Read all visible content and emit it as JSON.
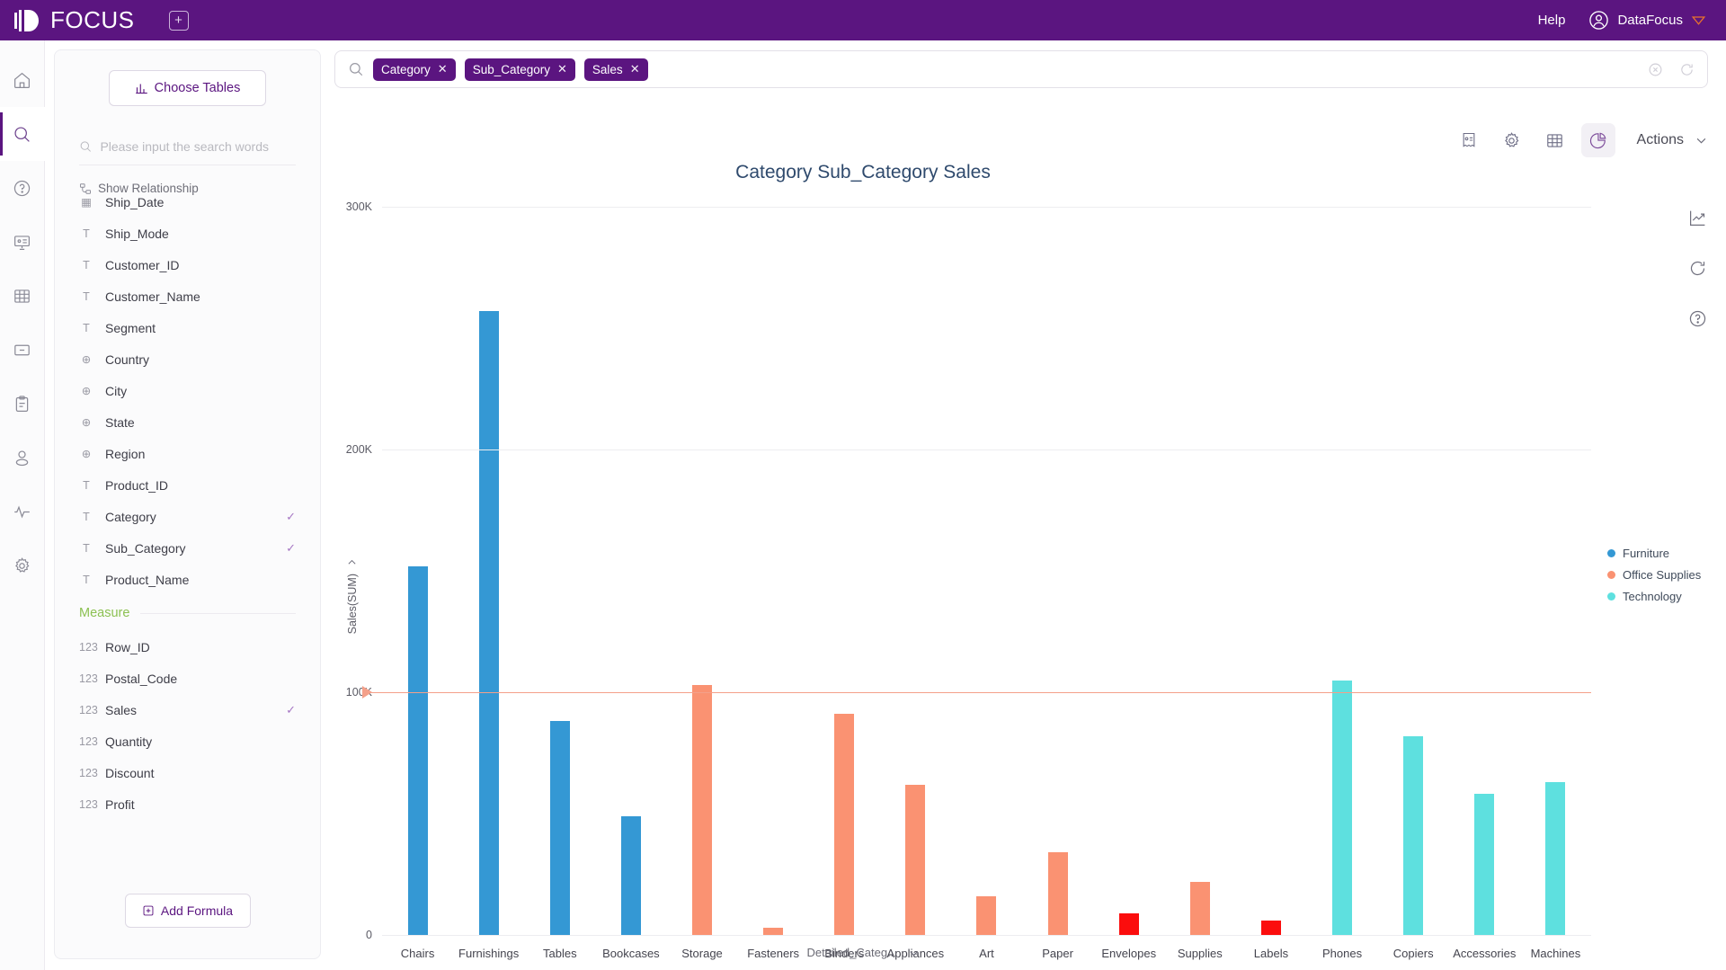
{
  "topbar": {
    "brand": "FOCUS",
    "new_tab_icon": "plus-square-icon",
    "help": "Help",
    "user": "DataFocus"
  },
  "rail": {
    "items": [
      {
        "icon": "home-icon",
        "name": "home"
      },
      {
        "icon": "search-icon",
        "name": "search",
        "active": true
      },
      {
        "icon": "question-circle-icon",
        "name": "help"
      },
      {
        "icon": "presentation-icon",
        "name": "dashboard"
      },
      {
        "icon": "table-grid-icon",
        "name": "tables"
      },
      {
        "icon": "folder-minus-icon",
        "name": "folder"
      },
      {
        "icon": "clipboard-icon",
        "name": "tasks"
      },
      {
        "icon": "user-icon",
        "name": "account"
      },
      {
        "icon": "activity-icon",
        "name": "monitor"
      },
      {
        "icon": "gear-icon",
        "name": "settings"
      }
    ]
  },
  "sidebar": {
    "choose_tables": "Choose Tables",
    "choose_tables_icon": "chart-bar-icon",
    "search_placeholder": "Please input the search words",
    "search_value": "",
    "search_icon": "search-icon",
    "show_relationship": "Show Relationship",
    "show_relationship_icon": "relationship-icon",
    "fields": [
      {
        "type": "date",
        "type_label": "▦",
        "label": "Ship_Date",
        "checked": false
      },
      {
        "type": "text",
        "type_label": "T",
        "label": "Ship_Mode",
        "checked": false
      },
      {
        "type": "text",
        "type_label": "T",
        "label": "Customer_ID",
        "checked": false
      },
      {
        "type": "text",
        "type_label": "T",
        "label": "Customer_Name",
        "checked": false
      },
      {
        "type": "text",
        "type_label": "T",
        "label": "Segment",
        "checked": false
      },
      {
        "type": "geo",
        "type_label": "⊕",
        "label": "Country",
        "checked": false
      },
      {
        "type": "geo",
        "type_label": "⊕",
        "label": "City",
        "checked": false
      },
      {
        "type": "geo",
        "type_label": "⊕",
        "label": "State",
        "checked": false
      },
      {
        "type": "geo",
        "type_label": "⊕",
        "label": "Region",
        "checked": false
      },
      {
        "type": "text",
        "type_label": "T",
        "label": "Product_ID",
        "checked": false
      },
      {
        "type": "text",
        "type_label": "T",
        "label": "Category",
        "checked": true
      },
      {
        "type": "text",
        "type_label": "T",
        "label": "Sub_Category",
        "checked": true
      },
      {
        "type": "text",
        "type_label": "T",
        "label": "Product_Name",
        "checked": false
      }
    ],
    "measure_header": "Measure",
    "measures": [
      {
        "type_label": "123",
        "label": "Row_ID",
        "checked": false
      },
      {
        "type_label": "123",
        "label": "Postal_Code",
        "checked": false
      },
      {
        "type_label": "123",
        "label": "Sales",
        "checked": true
      },
      {
        "type_label": "123",
        "label": "Quantity",
        "checked": false
      },
      {
        "type_label": "123",
        "label": "Discount",
        "checked": false
      },
      {
        "type_label": "123",
        "label": "Profit",
        "checked": false
      }
    ],
    "add_formula": "Add Formula",
    "add_formula_icon": "plus-square-icon"
  },
  "filterbar": {
    "search_icon": "search-icon",
    "chips": [
      "Category",
      "Sub_Category",
      "Sales"
    ],
    "chip_close_icon": "close-icon",
    "clear_icon": "clear-circle-icon",
    "refresh_icon": "refresh-icon"
  },
  "chart_toolbar": {
    "buttons": [
      {
        "icon": "receipt-icon",
        "name": "summary",
        "active": false
      },
      {
        "icon": "gear-icon",
        "name": "settings",
        "active": false
      },
      {
        "icon": "table-grid-icon",
        "name": "table-view",
        "active": false
      },
      {
        "icon": "pie-chart-icon",
        "name": "chart-view",
        "active": true
      }
    ],
    "actions_label": "Actions",
    "actions_caret_icon": "chevron-down-icon"
  },
  "right_tools": [
    {
      "icon": "trend-line-icon",
      "name": "trend"
    },
    {
      "icon": "refresh-icon",
      "name": "reset"
    },
    {
      "icon": "question-circle-icon",
      "name": "help"
    }
  ],
  "chart_data": {
    "type": "bar",
    "title": "Category Sub_Category Sales",
    "xlabel": "Detailed_Categ...",
    "xlabel_caret_icon": "chevron-down-icon",
    "ylabel": "Sales(SUM)",
    "ylabel_caret_icon": "chevron-right-icon",
    "ylim": [
      0,
      300000
    ],
    "yticks": [
      0,
      100000,
      200000,
      300000
    ],
    "ytick_labels": [
      "0",
      "100K",
      "200K",
      "300K"
    ],
    "grid": true,
    "legend_position": "right",
    "reference_line": {
      "value": 100000,
      "color": "#f4a08a"
    },
    "legend": [
      {
        "name": "Furniture",
        "color": "#3498d4"
      },
      {
        "name": "Office Supplies",
        "color": "#fa9272"
      },
      {
        "name": "Technology",
        "color": "#5ee0df"
      }
    ],
    "highlight_color": "#fb0d0d",
    "categories": [
      "Chairs",
      "Furnishings",
      "Tables",
      "Bookcases",
      "Storage",
      "Fasteners",
      "Binders",
      "Appliances",
      "Art",
      "Paper",
      "Envelopes",
      "Supplies",
      "Labels",
      "Phones",
      "Copiers",
      "Accessories",
      "Machines"
    ],
    "series": [
      {
        "name": "Sales(SUM)",
        "values": [
          152000,
          257000,
          88000,
          49000,
          103000,
          3000,
          91000,
          62000,
          16000,
          34000,
          9000,
          22000,
          6000,
          105000,
          82000,
          58000,
          63000
        ],
        "group": [
          "Furniture",
          "Furniture",
          "Furniture",
          "Furniture",
          "Office Supplies",
          "Office Supplies",
          "Office Supplies",
          "Office Supplies",
          "Office Supplies",
          "Office Supplies",
          "Office Supplies",
          "Office Supplies",
          "Office Supplies",
          "Technology",
          "Technology",
          "Technology",
          "Technology"
        ],
        "highlighted": [
          false,
          false,
          false,
          false,
          false,
          false,
          false,
          false,
          false,
          false,
          true,
          false,
          true,
          false,
          false,
          false,
          false
        ]
      }
    ]
  }
}
